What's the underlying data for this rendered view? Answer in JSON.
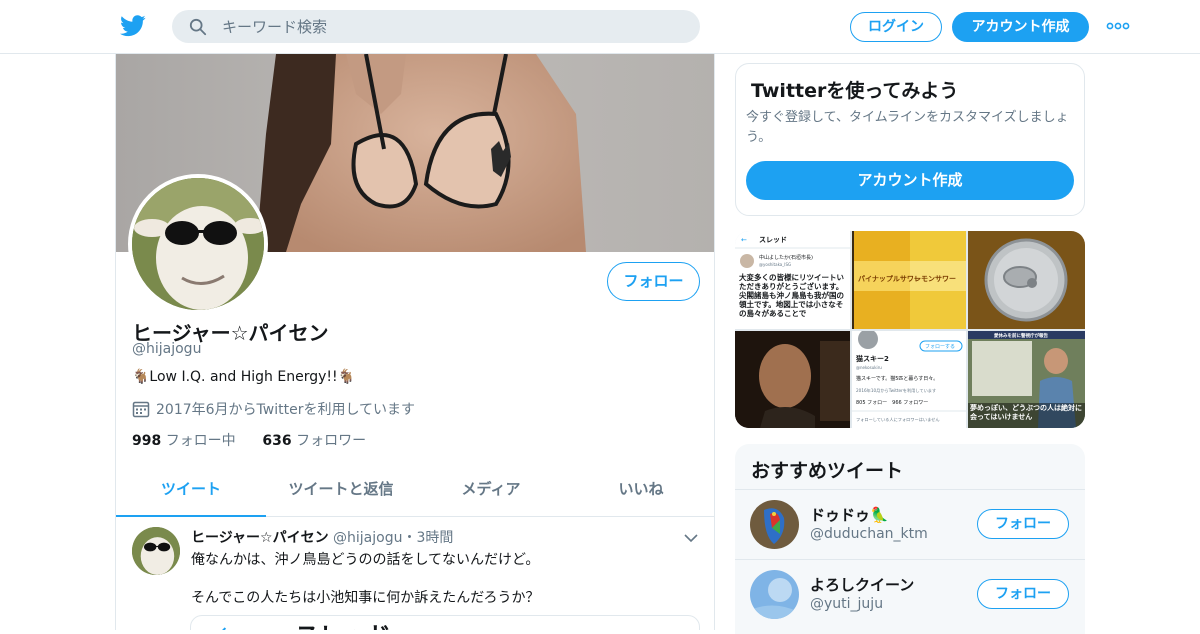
{
  "header": {
    "logo_icon": "twitter-bird-icon",
    "search_placeholder": "キーワード検索",
    "login_label": "ログイン",
    "signup_label": "アカウント作成",
    "more_icon": "more-dots-icon",
    "accent": "#1da1f2"
  },
  "profile": {
    "name": "ヒージャー☆パイセン",
    "handle": "@hijajogu",
    "bio": "🐐Low I.Q. and High Energy!!🐐",
    "joined": "2017年6月からTwitterを利用しています",
    "following_count": "998",
    "following_label": "フォロー中",
    "followers_count": "636",
    "followers_label": "フォロワー",
    "follow_label": "フォロー"
  },
  "tabs": [
    {
      "label": "ツイート",
      "active": true
    },
    {
      "label": "ツイートと返信",
      "active": false
    },
    {
      "label": "メディア",
      "active": false
    },
    {
      "label": "いいね",
      "active": false
    }
  ],
  "tweet": {
    "name": "ヒージャー☆パイセン",
    "handle": "@hijajogu",
    "sep": "・",
    "time": "3時間",
    "text1": "俺なんかは、沖ノ鳥島どうのの話をしてないんだけど。",
    "text2": "そんでこの人たちは小池知事に何か訴えたんだろうか？",
    "card_arrow": "←",
    "card_title": "スレッド"
  },
  "signup_card": {
    "title": "Twitterを使ってみよう",
    "subtitle": "今すぐ登録して、タイムラインをカスタマイズしましょう。",
    "cta": "アカウント作成"
  },
  "media_tiles": {
    "tile1_header": "スレッド",
    "tile1_name": "中山よしたか(石垣市長)",
    "tile1_handle": "@yoshitaka_ISG",
    "tile1_text": "大変多くの皆様にリツイートいただきありがとうございます。尖閣諸島も沖ノ鳥島も我が国の領土です。地図上では小さなその島々があることで",
    "tile2_label": "パイナップルサワー",
    "tile3_label": "レモンサワー",
    "tile5_name": "猫スキー2",
    "tile5_handle": "@nekosukiru",
    "tile5_follow": "フォローする",
    "tile5_bio": "猫スキーです。猫5匹と暮らす日々。",
    "tile5_joined": "2016年10月からTwitterを利用しています",
    "tile5_stats": "805 フォロー　966 フォロワー",
    "tile5_footer": "フォローしている人にフォロワーはいません",
    "tile6_sign": "愛休みを前に警視庁が報告",
    "tile6_caption": "夢めっぽい、どうぶつの人は絶対に会ってはいけません"
  },
  "recommended": {
    "title": "おすすめツイート",
    "users": [
      {
        "name": "ドゥドゥ🦜",
        "handle": "@duduchan_ktm",
        "follow_label": "フォロー"
      },
      {
        "name": "よろしクイーン",
        "handle": "@yuti_juju",
        "follow_label": "フォロー"
      }
    ]
  }
}
